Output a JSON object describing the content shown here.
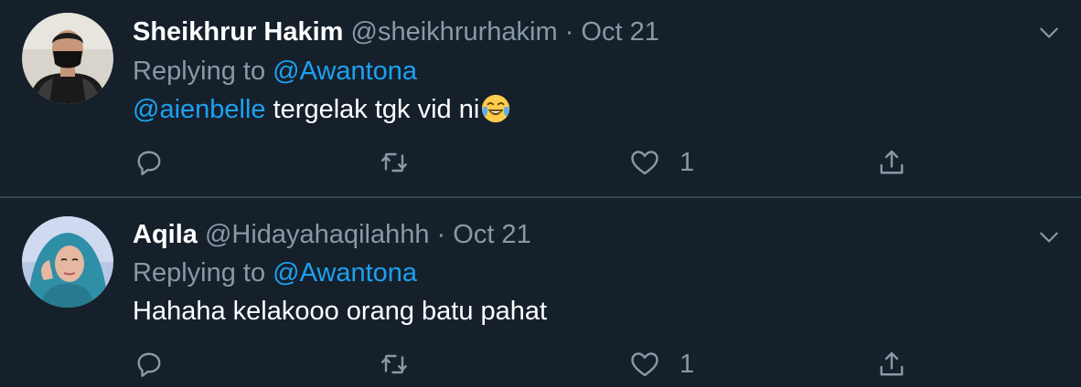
{
  "replies": [
    {
      "display_name": "Sheikhrur Hakim",
      "handle": "@sheikhrurhakim",
      "separator": "·",
      "date": "Oct 21",
      "replying_label": "Replying to",
      "replying_to": "@Awantona",
      "body_mention": "@aienbelle",
      "body_text": " tergelak tgk vid ni",
      "body_emoji": "face-with-tears-of-joy",
      "like_count": "1",
      "avatar_colors": {
        "bg": "#d8d4cc",
        "shirt": "#1a1a1a",
        "mask": "#111111"
      }
    },
    {
      "display_name": "Aqila",
      "handle": "@Hidayahaqilahhh",
      "separator": "·",
      "date": "Oct 21",
      "replying_label": "Replying to",
      "replying_to": "@Awantona",
      "body_text": "Hahaha kelakooo orang batu pahat",
      "like_count": "1",
      "avatar_colors": {
        "bg": "#b9c7e6",
        "hijab": "#2f8fa6",
        "skin": "#e6b8a2"
      }
    }
  ],
  "icons": {
    "reply": "reply-icon",
    "retweet": "retweet-icon",
    "like": "like-icon",
    "share": "share-icon",
    "caret": "chevron-down-icon"
  },
  "colors": {
    "background": "#15202b",
    "divider": "#38444d",
    "secondary_text": "#8899a6",
    "link": "#1da1f2",
    "primary_text": "#ffffff"
  }
}
